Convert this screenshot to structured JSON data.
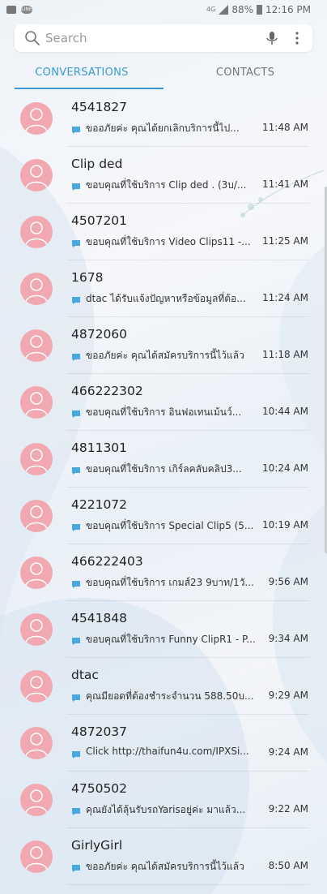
{
  "status_bar": {
    "network_small": "4G",
    "battery_percent": "88%",
    "time": "12:16 PM"
  },
  "search": {
    "placeholder": "Search"
  },
  "tabs": [
    {
      "label": "CONVERSATIONS",
      "active": true
    },
    {
      "label": "CONTACTS",
      "active": false
    }
  ],
  "colors": {
    "accent": "#3b9ad4",
    "avatar": "#f2a8b1",
    "message_icon": "#4aa8e0"
  },
  "conversations": [
    {
      "name": "4541827",
      "preview": "ขออภัยค่ะ คุณได้ยกเลิกบริการนี้ไป...",
      "time": "11:48 AM"
    },
    {
      "name": "Clip ded",
      "preview": "ขอบคุณที่ใช้บริการ Clip ded . (3บ/...",
      "time": "11:41 AM"
    },
    {
      "name": "4507201",
      "preview": "ขอบคุณที่ใช้บริการ Video Clips11 -...",
      "time": "11:25 AM"
    },
    {
      "name": "1678",
      "preview": "dtac ได้รับแจ้งปัญหาหรือข้อมูลที่ต้อ...",
      "time": "11:24 AM"
    },
    {
      "name": "4872060",
      "preview": "ขออภัยค่ะ คุณได้สมัครบริการนี้ไว้แล้ว",
      "time": "11:18 AM"
    },
    {
      "name": "466222302",
      "preview": "ขอบคุณที่ใช้บริการ อินฟอเทนเม้นว์...",
      "time": "10:44 AM"
    },
    {
      "name": "4811301",
      "preview": "ขอบคุณที่ใช้บริการ เกิร์ลคลับคลิป3...",
      "time": "10:24 AM"
    },
    {
      "name": "4221072",
      "preview": "ขอบคุณที่ใช้บริการ Special Clip5 (5...",
      "time": "10:19 AM"
    },
    {
      "name": "466222403",
      "preview": "ขอบคุณที่ใช้บริการ เกมส์23 9บาท/1วั...",
      "time": "9:56 AM"
    },
    {
      "name": "4541848",
      "preview": "ขอบคุณที่ใช้บริการ Funny ClipR1 - P...",
      "time": "9:34 AM"
    },
    {
      "name": "dtac",
      "preview": "คุณมียอดที่ต้องชำระจำนวน 588.50บ...",
      "time": "9:29 AM"
    },
    {
      "name": "4872037",
      "preview": "Click http://thaifun4u.com/IPXSi...",
      "time": "9:24 AM"
    },
    {
      "name": "4750502",
      "preview": "คุณยังได้ลุ้นรับรถYarisอยู่ค่ะ มาแล้ว...",
      "time": "9:22 AM"
    },
    {
      "name": "GirlyGirl",
      "preview": "ขออภัยค่ะ คุณได้สมัครบริการนี้ไว้แล้ว",
      "time": "8:50 AM"
    }
  ]
}
